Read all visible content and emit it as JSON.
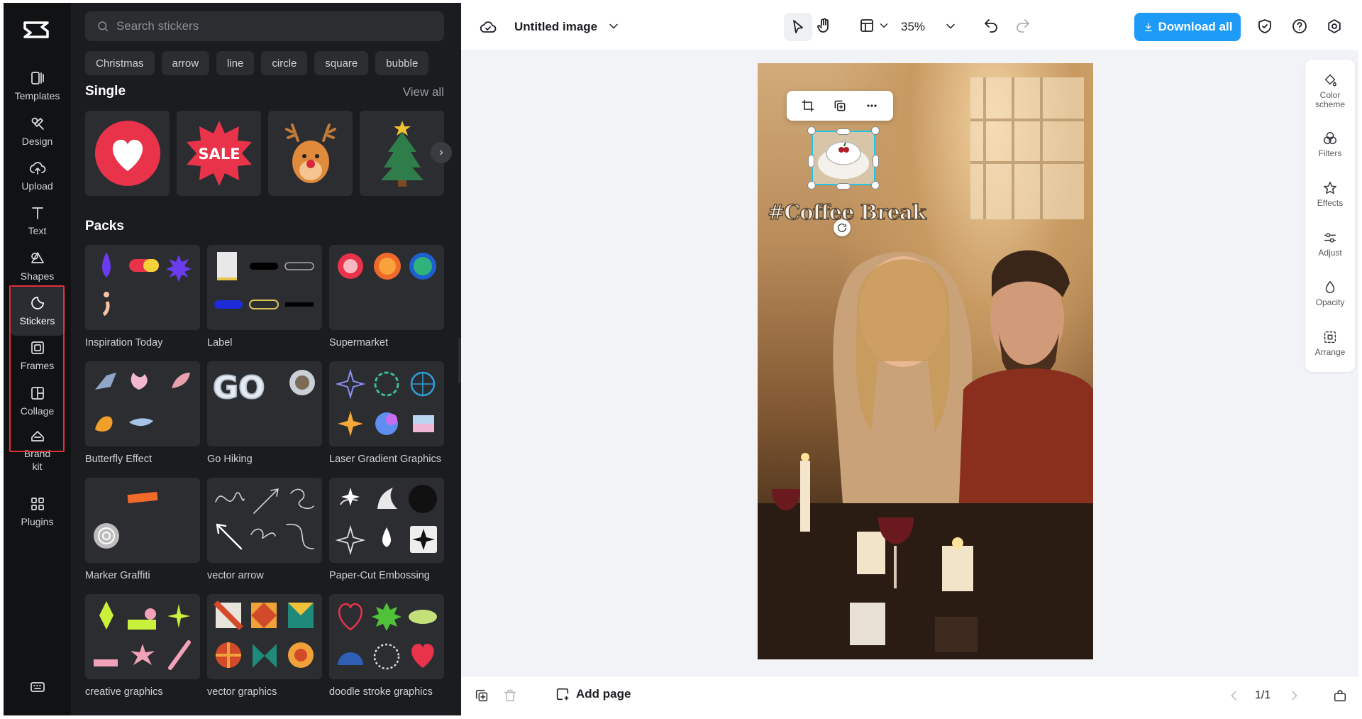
{
  "rail": {
    "items": [
      {
        "label": "Templates",
        "icon": "templates-icon"
      },
      {
        "label": "Design",
        "icon": "design-icon"
      },
      {
        "label": "Upload",
        "icon": "upload-icon"
      },
      {
        "label": "Text",
        "icon": "text-icon"
      },
      {
        "label": "Shapes",
        "icon": "shapes-icon"
      },
      {
        "label": "Stickers",
        "icon": "stickers-icon",
        "active": true
      },
      {
        "label": "Frames",
        "icon": "frames-icon"
      },
      {
        "label": "Collage",
        "icon": "collage-icon"
      },
      {
        "label": "Brand kit",
        "icon": "brand-kit-icon"
      },
      {
        "label": "Plugins",
        "icon": "plugins-icon"
      }
    ],
    "highlight_color": "#e0303d"
  },
  "panel": {
    "search_placeholder": "Search stickers",
    "chips": [
      "Christmas",
      "arrow",
      "line",
      "circle",
      "square",
      "bubble"
    ],
    "single_title": "Single",
    "view_all": "View all",
    "single_stickers": [
      "heart-sticker",
      "sale-sticker",
      "reindeer-sticker",
      "christmas-tree-sticker"
    ],
    "sale_text": "SALE",
    "packs_title": "Packs",
    "packs": [
      {
        "label": "Inspiration Today"
      },
      {
        "label": "Label"
      },
      {
        "label": "Supermarket"
      },
      {
        "label": "Butterfly Effect"
      },
      {
        "label": "Go Hiking"
      },
      {
        "label": "Laser Gradient Graphics"
      },
      {
        "label": "Marker Graffiti"
      },
      {
        "label": "vector arrow"
      },
      {
        "label": "Paper-Cut Embossing"
      },
      {
        "label": "creative graphics"
      },
      {
        "label": "vector graphics"
      },
      {
        "label": "doodle stroke graphics"
      }
    ]
  },
  "topbar": {
    "title": "Untitled image",
    "zoom": "35%",
    "download_label": "Download all",
    "accent": "#1e9bf7"
  },
  "canvas": {
    "overlay_text": "#Coffee Break"
  },
  "right_rail": [
    {
      "label": "Color scheme"
    },
    {
      "label": "Filters"
    },
    {
      "label": "Effects"
    },
    {
      "label": "Adjust"
    },
    {
      "label": "Opacity"
    },
    {
      "label": "Arrange"
    }
  ],
  "bottombar": {
    "add_page": "Add page",
    "page_indicator": "1/1"
  }
}
